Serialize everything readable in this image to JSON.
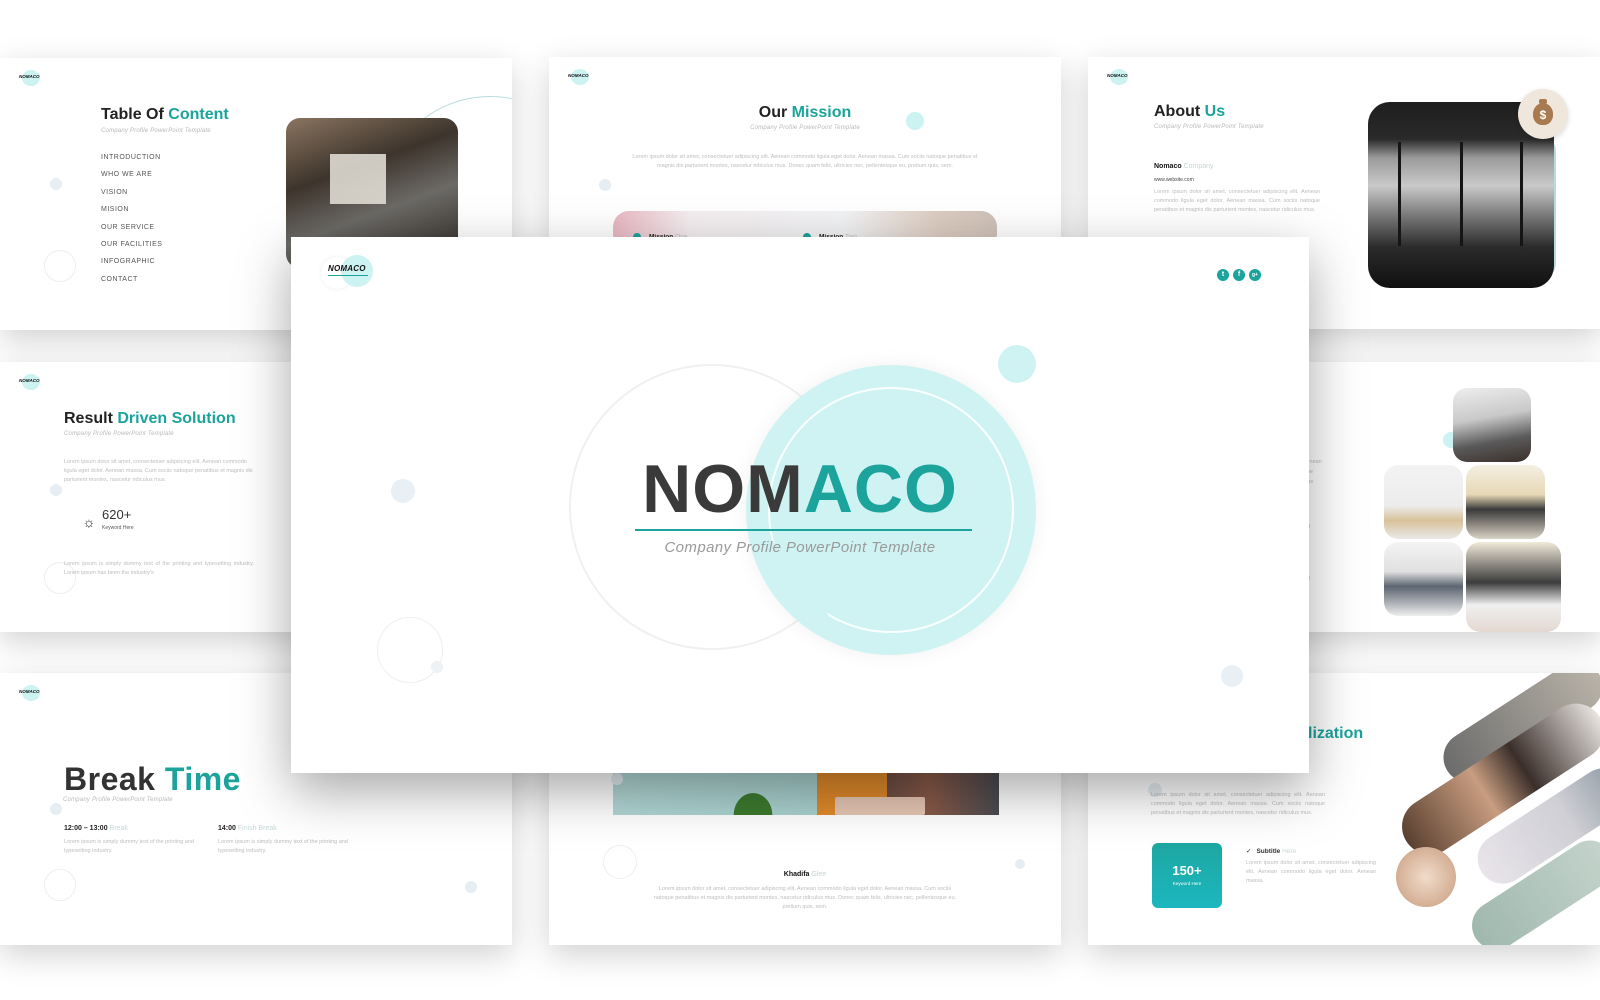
{
  "brand": {
    "name_dark": "NOM",
    "name_teal": "ACO",
    "logo_text": "NOMACO",
    "tagline": "Company Profile PowerPoint Template",
    "accent_color": "#1ba39c",
    "light_accent_color": "#cff3f3"
  },
  "main_slide": {
    "social_icons": [
      {
        "name": "twitter-icon",
        "glyph": "t"
      },
      {
        "name": "facebook-icon",
        "glyph": "f"
      },
      {
        "name": "google-plus-icon",
        "glyph": "g+"
      }
    ]
  },
  "toc_slide": {
    "title_dark": "Table Of",
    "title_teal": "Content",
    "subtitle": "Company Profile PowerPoint Template",
    "items": [
      "INTRODUCTION",
      "WHO WE ARE",
      "VISION",
      "MISION",
      "OUR SERVICE",
      "OUR FACILITIES",
      "INFOGRAPHIC",
      "CONTACT"
    ]
  },
  "mission_slide": {
    "title_dark": "Our",
    "title_teal": "Mission",
    "subtitle": "Company Profile PowerPoint Template",
    "body": "Lorem ipsum dolor sit amet, consectetuer adipiscing elit. Aenean commodo ligula eget dolor. Aenean massa. Cum sociis natoque penatibus et magnis dis parturient montes, nascetur ridiculus mus. Donec quam felis, ultricies nec, pellentesque eu, pretium quis, sem.",
    "items": [
      {
        "bold": "Mission",
        "light": "One"
      },
      {
        "bold": "Mission",
        "light": "Two"
      }
    ]
  },
  "about_slide": {
    "title_dark": "About",
    "title_teal": "Us",
    "subtitle": "Company Profile PowerPoint Template",
    "company_bold": "Nomaco",
    "company_light": "Company",
    "website": "www.website.com",
    "body": "Lorem ipsum dolor sit amet, consectetuer adipiscing elit. Aenean commodo ligula eget dolor. Aenean massa. Cum sociis natoque penatibus et magnis dis parturient montes, nascetur ridiculus mus.",
    "badge_glyph": "$"
  },
  "result_slide": {
    "title_dark": "Result",
    "title_teal": "Driven Solution",
    "subtitle": "Company Profile PowerPoint Template",
    "body1": "Lorem ipsum dolor sit amet, consectetuer adipiscing elit. Aenean commodo ligula eget dolor. Aenean massa. Cum sociis natoque penatibus et magnis dis parturient montes, nascetur ridiculus mus.",
    "stat_value": "620+",
    "stat_label": "Keyword Here",
    "body2": "Lorem ipsum is simply dummy text of the printing and typesetting industry. Lorem ipsum has been the industry's"
  },
  "break_slide": {
    "title_dark": "Break",
    "title_teal": "Time",
    "subtitle": "Company Profile PowerPoint Template",
    "columns": [
      {
        "time": "12:00 – 13:00",
        "label": "Break",
        "desc": "Lorem ipsum is simply dummy text of the printing and typesetting industry."
      },
      {
        "time": "14:00",
        "label": "Finish Break",
        "desc": "Lorem ipsum is simply dummy text of the printing and typesetting industry."
      }
    ]
  },
  "profile_slide": {
    "name_bold": "Khadifa",
    "name_light": "Glee",
    "body": "Lorem ipsum dolor sit amet, consectetuer adipiscing elit. Aenean commodo ligula eget dolor. Aenean massa. Cum sociis natoque penatibus et magnis dis parturient montes, nascetur ridiculus mus. Donec quam felis, ultricies nec, pellentesque eu, pretium quis, sem."
  },
  "personalization_slide": {
    "title_partial": "lization",
    "body": "Lorem ipsum dolor sit amet, consectetuer adipiscing elit. Aenean commodo ligula eget dolor. Aenean massa. Cum sociis natoque penatibus et magnis dis parturient montes, nascetur ridiculus mus.",
    "kpi_value": "150+",
    "kpi_label": "Keyword Here",
    "check_glyph": "✓",
    "subtitle_bold": "Subtitle",
    "subtitle_light": "Here",
    "subtitle_body": "Lorem ipsum dolor sit amet, consectetuer adipiscing elit. Aenean commodo ligula eget dolor. Aenean massa."
  },
  "gallery_slide": {
    "side_text": [
      "elit. Aenean",
      "natoque",
      "ridiculus",
      "piscing",
      "piscing"
    ]
  }
}
